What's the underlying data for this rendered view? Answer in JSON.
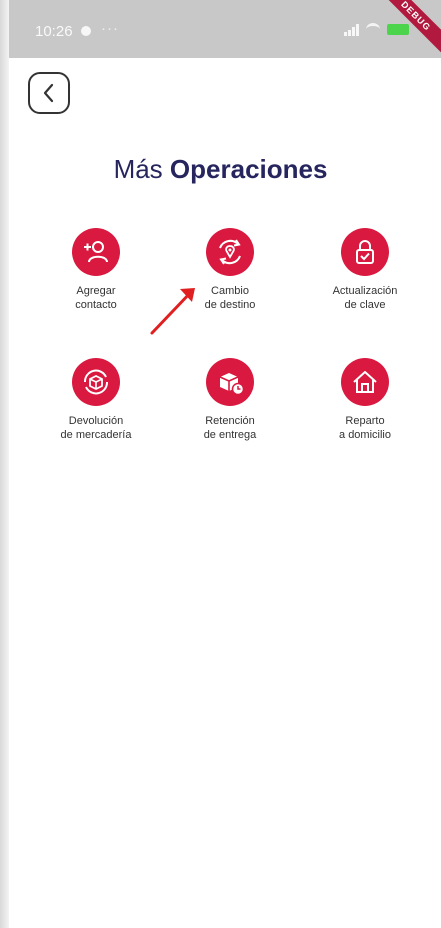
{
  "status_bar": {
    "time": "10:26",
    "more": "···"
  },
  "debug_banner": "DEBUG",
  "header": {
    "title_light": "Más",
    "title_bold": "Operaciones"
  },
  "operations": [
    {
      "label": "Agregar\ncontacto",
      "icon": "add-user-icon"
    },
    {
      "label": "Cambio\nde destino",
      "icon": "location-change-icon"
    },
    {
      "label": "Actualización\nde clave",
      "icon": "lock-icon"
    },
    {
      "label": "Devolución\nde mercadería",
      "icon": "package-return-icon"
    },
    {
      "label": "Retención\nde entrega",
      "icon": "package-hold-icon"
    },
    {
      "label": "Reparto\na domicilio",
      "icon": "home-icon"
    }
  ],
  "colors": {
    "accent": "#d9193f",
    "title": "#26255e",
    "annotation_arrow": "#e02020"
  }
}
